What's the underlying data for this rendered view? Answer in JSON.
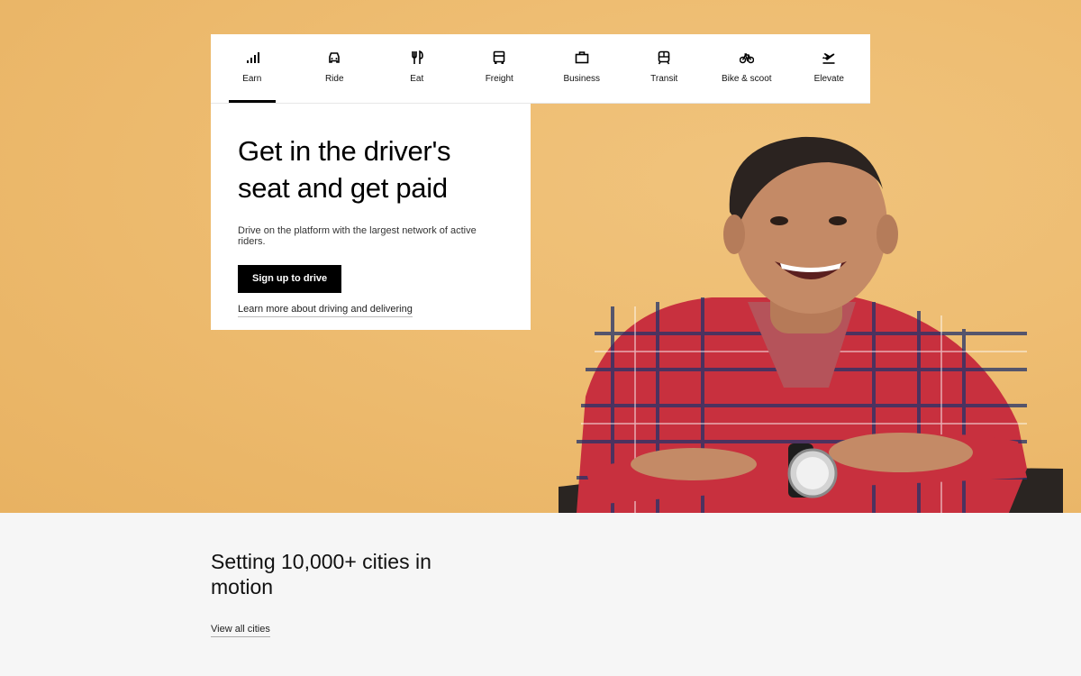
{
  "tabs": [
    {
      "label": "Earn",
      "icon": "signal-bars-icon"
    },
    {
      "label": "Ride",
      "icon": "car-icon"
    },
    {
      "label": "Eat",
      "icon": "fork-knife-icon"
    },
    {
      "label": "Freight",
      "icon": "truck-icon"
    },
    {
      "label": "Business",
      "icon": "briefcase-icon"
    },
    {
      "label": "Transit",
      "icon": "train-icon"
    },
    {
      "label": "Bike & scoot",
      "icon": "bicycle-icon"
    },
    {
      "label": "Elevate",
      "icon": "plane-icon"
    }
  ],
  "active_tab": "Earn",
  "hero": {
    "title": "Get in the driver's seat and get paid",
    "subtitle": "Drive on the platform with the largest network of active riders.",
    "cta_label": "Sign up to drive",
    "learn_link": "Learn more about driving and delivering",
    "background_color": "#eebd72"
  },
  "cities": {
    "title": "Setting 10,000+ cities in motion",
    "link": "View all cities"
  }
}
